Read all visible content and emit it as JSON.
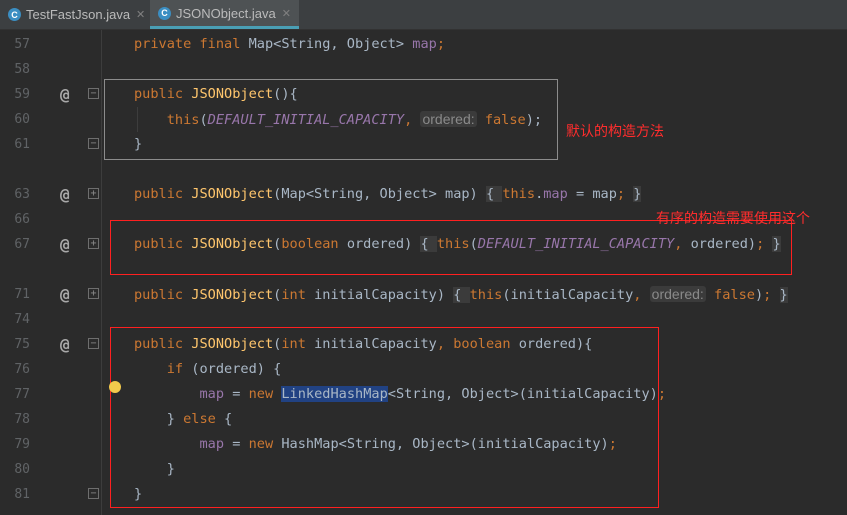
{
  "tabs": [
    {
      "label": "TestFastJson.java",
      "active": false
    },
    {
      "label": "JSONObject.java",
      "active": true
    }
  ],
  "colors": {
    "background": "#2b2b2b",
    "keyword": "#cc7832",
    "method": "#ffc66d",
    "field": "#9876aa",
    "annotation_red": "#ff2d2d"
  },
  "lines": [
    {
      "num": "57",
      "at": false,
      "fold": "",
      "tokens": [
        [
          "private final ",
          "kw"
        ],
        [
          "Map<String, Object> ",
          ""
        ],
        [
          "map",
          "fld"
        ],
        [
          ";",
          "kw"
        ]
      ]
    },
    {
      "num": "58",
      "at": false,
      "fold": "",
      "tokens": []
    },
    {
      "num": "59",
      "at": true,
      "fold": "−",
      "tokens": [
        [
          "public ",
          "kw"
        ],
        [
          "JSONObject",
          "fn"
        ],
        [
          "(){",
          ""
        ]
      ]
    },
    {
      "num": "60",
      "at": false,
      "fold": "",
      "tokens": [
        [
          "    this",
          "kw"
        ],
        [
          "(",
          ""
        ],
        [
          "DEFAULT_INITIAL_CAPACITY",
          "cst"
        ],
        [
          ",",
          "kw"
        ],
        [
          " ",
          ""
        ],
        [
          "ordered:",
          "hint"
        ],
        [
          " ",
          ""
        ],
        [
          "false",
          "kw"
        ],
        [
          ");",
          ""
        ]
      ]
    },
    {
      "num": "61",
      "at": false,
      "fold": "−",
      "tokens": [
        [
          "}",
          ""
        ]
      ]
    },
    {
      "num": "",
      "at": false,
      "fold": "",
      "tokens": []
    },
    {
      "num": "63",
      "at": true,
      "fold": "+",
      "tokens": [
        [
          "public ",
          "kw"
        ],
        [
          "JSONObject",
          "fn"
        ],
        [
          "(Map<String, Object> map) ",
          ""
        ],
        [
          "{ ",
          "fb"
        ],
        [
          "this",
          "kw"
        ],
        [
          ".",
          ""
        ],
        [
          "map",
          "fld"
        ],
        [
          " = map",
          ""
        ],
        [
          ";",
          "kw"
        ],
        [
          " ",
          ""
        ],
        [
          "}",
          "fb"
        ]
      ]
    },
    {
      "num": "66",
      "at": false,
      "fold": "",
      "tokens": []
    },
    {
      "num": "67",
      "at": true,
      "fold": "+",
      "tokens": [
        [
          "public ",
          "kw"
        ],
        [
          "JSONObject",
          "fn"
        ],
        [
          "(",
          ""
        ],
        [
          "boolean ",
          "kw"
        ],
        [
          "ordered) ",
          ""
        ],
        [
          "{ ",
          "fb"
        ],
        [
          "this",
          "kw"
        ],
        [
          "(",
          ""
        ],
        [
          "DEFAULT_INITIAL_CAPACITY",
          "cst"
        ],
        [
          ",",
          "kw"
        ],
        [
          " ordered)",
          ""
        ],
        [
          ";",
          "kw"
        ],
        [
          " ",
          ""
        ],
        [
          "}",
          "fb"
        ]
      ]
    },
    {
      "num": "",
      "at": false,
      "fold": "",
      "tokens": []
    },
    {
      "num": "71",
      "at": true,
      "fold": "+",
      "tokens": [
        [
          "public ",
          "kw"
        ],
        [
          "JSONObject",
          "fn"
        ],
        [
          "(",
          ""
        ],
        [
          "int ",
          "kw"
        ],
        [
          "initialCapacity) ",
          ""
        ],
        [
          "{ ",
          "fb"
        ],
        [
          "this",
          "kw"
        ],
        [
          "(initialCapacity",
          ""
        ],
        [
          ",",
          "kw"
        ],
        [
          " ",
          ""
        ],
        [
          "ordered:",
          "hint"
        ],
        [
          " ",
          ""
        ],
        [
          "false",
          "kw"
        ],
        [
          ")",
          ""
        ],
        [
          ";",
          "kw"
        ],
        [
          " ",
          ""
        ],
        [
          "}",
          "fb"
        ]
      ]
    },
    {
      "num": "74",
      "at": false,
      "fold": "",
      "tokens": []
    },
    {
      "num": "75",
      "at": true,
      "fold": "−",
      "tokens": [
        [
          "public ",
          "kw"
        ],
        [
          "JSONObject",
          "fn"
        ],
        [
          "(",
          ""
        ],
        [
          "int ",
          "kw"
        ],
        [
          "initialCapacity",
          ""
        ],
        [
          ", ",
          "kw"
        ],
        [
          "boolean ",
          "kw"
        ],
        [
          "ordered){",
          ""
        ]
      ]
    },
    {
      "num": "76",
      "at": false,
      "fold": "",
      "tokens": [
        [
          "    if ",
          "kw"
        ],
        [
          "(ordered) {",
          ""
        ]
      ]
    },
    {
      "num": "77",
      "at": false,
      "fold": "",
      "tokens": [
        [
          "        ",
          ""
        ],
        [
          "map",
          "fld"
        ],
        [
          " = ",
          ""
        ],
        [
          "new ",
          "kw"
        ],
        [
          "LinkedHashMap",
          "sel"
        ],
        [
          "<String, Object>(initialCapacity)",
          ""
        ],
        [
          ";",
          "kw"
        ]
      ]
    },
    {
      "num": "78",
      "at": false,
      "fold": "",
      "tokens": [
        [
          "    } ",
          ""
        ],
        [
          "else ",
          "kw"
        ],
        [
          "{",
          ""
        ]
      ]
    },
    {
      "num": "79",
      "at": false,
      "fold": "",
      "tokens": [
        [
          "        ",
          ""
        ],
        [
          "map",
          "fld"
        ],
        [
          " = ",
          ""
        ],
        [
          "new ",
          "kw"
        ],
        [
          "HashMap<String, Object>(initialCapacity)",
          ""
        ],
        [
          ";",
          "kw"
        ]
      ]
    },
    {
      "num": "80",
      "at": false,
      "fold": "",
      "tokens": [
        [
          "    }",
          ""
        ]
      ]
    },
    {
      "num": "81",
      "at": false,
      "fold": "−",
      "tokens": [
        [
          "}",
          ""
        ]
      ]
    }
  ],
  "annotations": {
    "default_constructor": "默认的构造方法",
    "ordered_constructor": "有序的构造需要使用这个"
  }
}
